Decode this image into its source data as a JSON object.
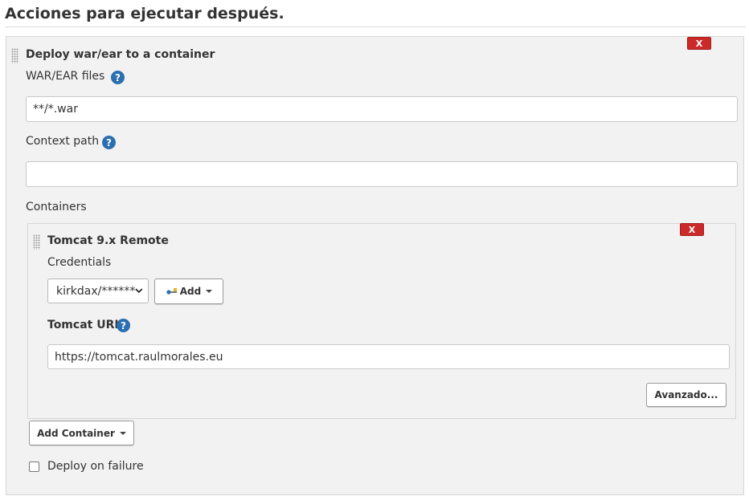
{
  "section": {
    "title": "Acciones para ejecutar después."
  },
  "deploy": {
    "title": "Deploy war/ear to a container",
    "delete_label": "X",
    "war_label": "WAR/EAR files",
    "war_value": "**/*.war",
    "context_label": "Context path",
    "context_value": "",
    "containers_label": "Containers",
    "help_glyph": "?"
  },
  "container": {
    "title": "Tomcat 9.x Remote",
    "delete_label": "X",
    "credentials_label": "Credentials",
    "credentials_selected": "kirkdax/******",
    "add_label": "Add",
    "tomcat_url_label": "Tomcat URL",
    "tomcat_url_value": "https://tomcat.raulmorales.eu",
    "advanced_label": "Avanzado..."
  },
  "add_container_label": "Add Container",
  "deploy_on_failure": {
    "label": "Deploy on failure",
    "checked": false
  },
  "colors": {
    "delete": "#cc2a2a",
    "help": "#2a6fb0",
    "panel": "#f2f2f2"
  },
  "icons": {
    "drag": "drag-handle-icon",
    "help": "help-icon",
    "key": "key-icon",
    "dropdown": "chevron-down-icon"
  }
}
